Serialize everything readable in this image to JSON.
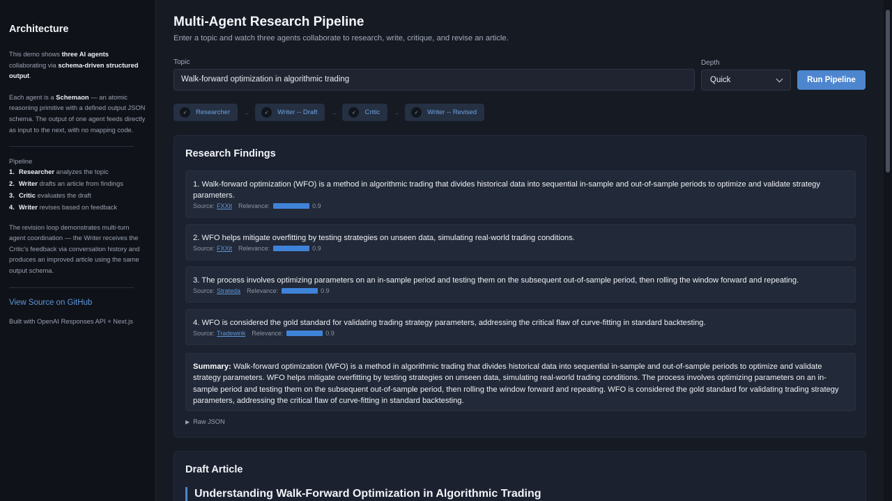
{
  "sidebar": {
    "title": "Architecture",
    "intro": {
      "p1_a": "This demo shows ",
      "p1_b": "three AI agents",
      "p1_c": " collaborating via ",
      "p1_d": "schema-driven structured output",
      "p1_e": ".",
      "p2_a": "Each agent is a ",
      "p2_b": "Schemaon",
      "p2_c": " — an atomic reasoning primitive with a defined output JSON schema. The output of one agent feeds directly as input to the next, with no mapping code."
    },
    "pipeline_label": "Pipeline",
    "pipeline": [
      {
        "num": "1.",
        "name": "Researcher",
        "desc": " analyzes the topic"
      },
      {
        "num": "2.",
        "name": "Writer",
        "desc": " drafts an article from findings"
      },
      {
        "num": "3.",
        "name": "Critic",
        "desc": " evaluates the draft"
      },
      {
        "num": "4.",
        "name": "Writer",
        "desc": " revises based on feedback"
      }
    ],
    "revision_text": "The revision loop demonstrates multi-turn agent coordination — the Writer receives the Critic's feedback via conversation history and produces an improved article using the same output schema.",
    "github_link": "View Source on GitHub",
    "built_with": "Built with OpenAI Responses API + Next.js"
  },
  "header": {
    "title": "Multi-Agent Research Pipeline",
    "subtitle": "Enter a topic and watch three agents collaborate to research, write, critique, and revise an article."
  },
  "form": {
    "topic_label": "Topic",
    "topic_value": "Walk-forward optimization in algorithmic trading",
    "depth_label": "Depth",
    "depth_value": "Quick",
    "run_label": "Run Pipeline"
  },
  "steps": [
    {
      "label": "Researcher",
      "check": "✓"
    },
    {
      "label": "Writer -- Draft",
      "check": "✓"
    },
    {
      "label": "Critic",
      "check": "✓"
    },
    {
      "label": "Writer -- Revised",
      "check": "✓"
    }
  ],
  "step_separator": "→",
  "research": {
    "title": "Research Findings",
    "source_label": "Source:",
    "relevance_label": "Relevance:",
    "findings": [
      {
        "text": "1. Walk-forward optimization (WFO) is a method in algorithmic trading that divides historical data into sequential in-sample and out-of-sample periods to optimize and validate strategy parameters.",
        "source": "FXXit",
        "relevance": "0.9",
        "relevance_value": 0.9
      },
      {
        "text": "2. WFO helps mitigate overfitting by testing strategies on unseen data, simulating real-world trading conditions.",
        "source": "FXXit",
        "relevance": "0.9",
        "relevance_value": 0.9
      },
      {
        "text": "3. The process involves optimizing parameters on an in-sample period and testing them on the subsequent out-of-sample period, then rolling the window forward and repeating.",
        "source": "Strateda",
        "relevance": "0.9",
        "relevance_value": 0.9
      },
      {
        "text": "4. WFO is considered the gold standard for validating trading strategy parameters, addressing the critical flaw of curve-fitting in standard backtesting.",
        "source": "Tradewink",
        "relevance": "0.9",
        "relevance_value": 0.9
      }
    ],
    "summary_label": "Summary:",
    "summary_text": " Walk-forward optimization (WFO) is a method in algorithmic trading that divides historical data into sequential in-sample and out-of-sample periods to optimize and validate strategy parameters. WFO helps mitigate overfitting by testing strategies on unseen data, simulating real-world trading conditions. The process involves optimizing parameters on an in-sample period and testing them on the subsequent out-of-sample period, then rolling the window forward and repeating. WFO is considered the gold standard for validating trading strategy parameters, addressing the critical flaw of curve-fitting in standard backtesting.",
    "raw_json_label": "Raw JSON",
    "raw_json_icon": "▶"
  },
  "draft": {
    "title": "Draft Article",
    "article_title": "Understanding Walk-Forward Optimization in Algorithmic Trading"
  },
  "colors": {
    "accent": "#4d86cf",
    "link": "#5e97dc",
    "relevance_bar": "#3f83d8"
  }
}
